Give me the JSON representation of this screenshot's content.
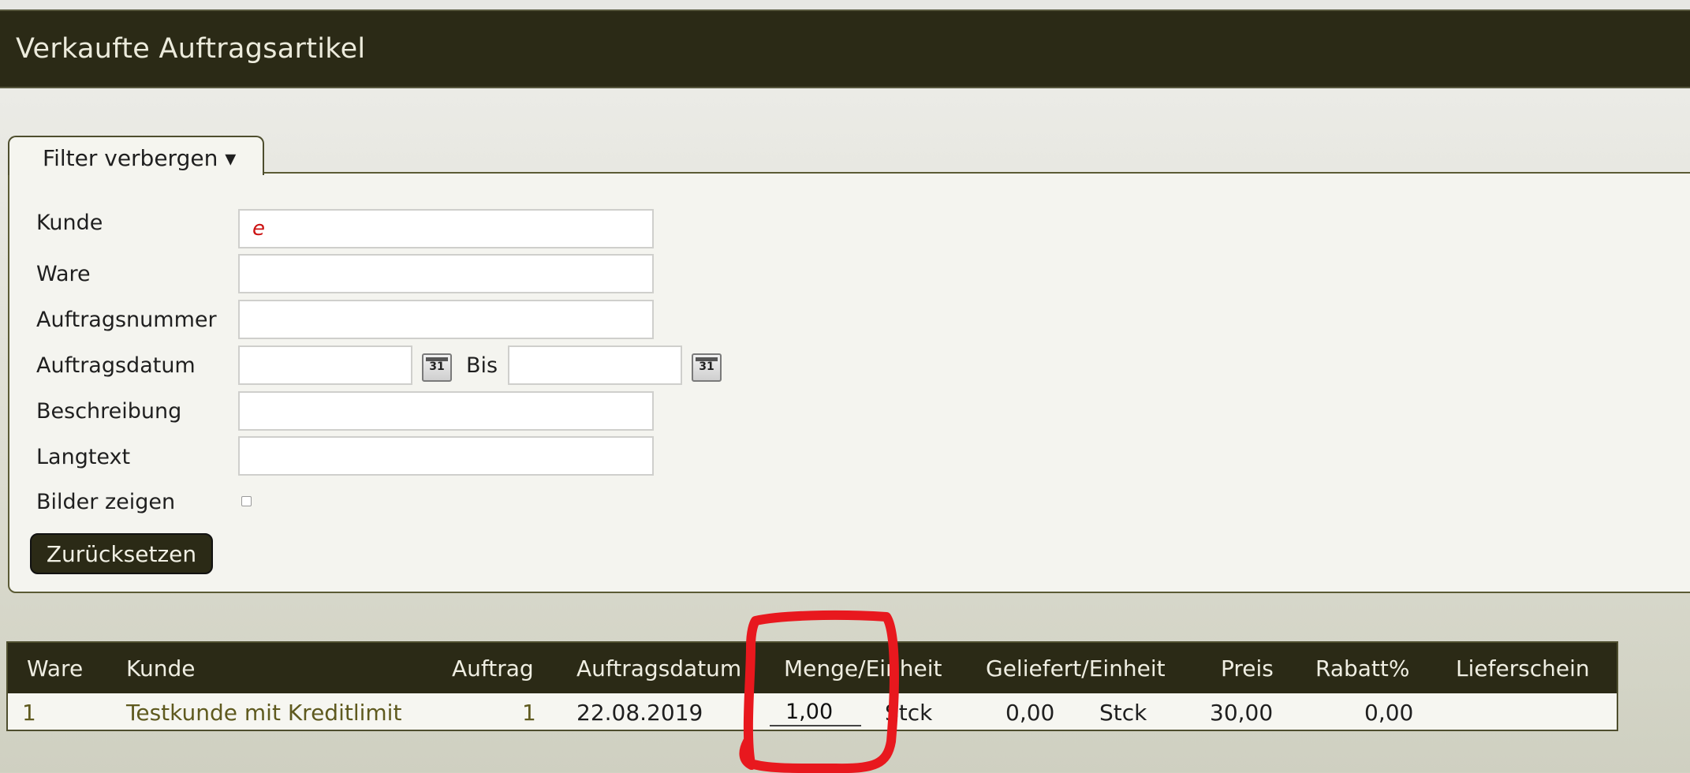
{
  "page": {
    "title": "Verkaufte Auftragsartikel"
  },
  "filter": {
    "toggle_label": "Filter verbergen ▾",
    "fields": {
      "kunde_label": "Kunde",
      "kunde_value": "e",
      "ware_label": "Ware",
      "ware_value": "",
      "auftragsnummer_label": "Auftragsnummer",
      "auftragsnummer_value": "",
      "auftragsdatum_label": "Auftragsdatum",
      "auftragsdatum_from": "",
      "bis_label": "Bis",
      "auftragsdatum_to": "",
      "beschreibung_label": "Beschreibung",
      "beschreibung_value": "",
      "langtext_label": "Langtext",
      "langtext_value": "",
      "bilder_label": "Bilder zeigen"
    },
    "calendar_icon_text": "31",
    "reset_label": "Zurücksetzen"
  },
  "table": {
    "headers": {
      "ware": "Ware",
      "kunde": "Kunde",
      "auftrag": "Auftrag",
      "auftragsdatum": "Auftragsdatum",
      "menge": "Menge/Einheit",
      "geliefert": "Geliefert/Einheit",
      "preis": "Preis",
      "rabatt": "Rabatt%",
      "lieferschein": "Lieferschein"
    },
    "rows": [
      {
        "ware": "1",
        "kunde": "Testkunde mit Kreditlimit",
        "auftrag": "1",
        "datum": "22.08.2019",
        "menge": "1,00",
        "menge_einheit": "Stck",
        "geliefert": "0,00",
        "geliefert_einheit": "Stck",
        "preis": "30,00",
        "rabatt": "0,00",
        "lieferschein": ""
      }
    ]
  },
  "colors": {
    "header_bg": "#2b2a16",
    "annotation_red": "#e8181e",
    "link": "#5f5a1f"
  }
}
